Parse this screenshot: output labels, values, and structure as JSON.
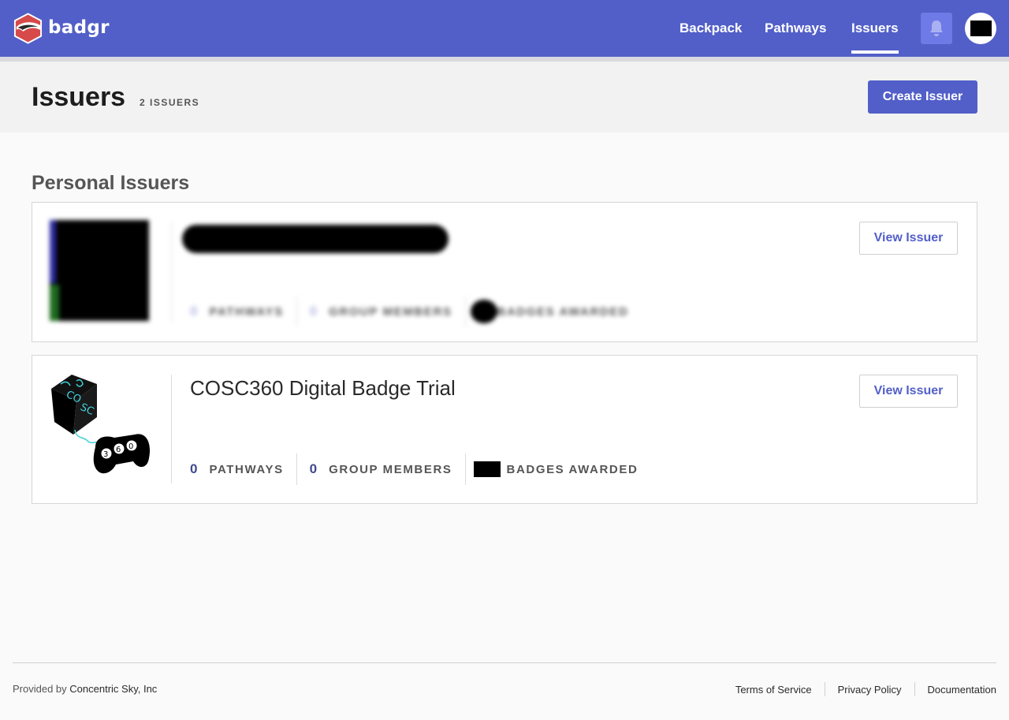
{
  "brand": {
    "name": "badgr",
    "primary": "#525fc8",
    "accent": "#6e7ae6"
  },
  "nav": {
    "items": [
      {
        "label": "Backpack",
        "active": false
      },
      {
        "label": "Pathways",
        "active": false
      },
      {
        "label": "Issuers",
        "active": true
      }
    ],
    "notifications_icon": "bell-icon"
  },
  "header": {
    "title": "Issuers",
    "count": "2 ISSUERS",
    "create_button": "Create Issuer"
  },
  "section": {
    "title": "Personal Issuers"
  },
  "issuers": [
    {
      "name": "",
      "redacted": true,
      "view_button": "View Issuer",
      "stats": [
        {
          "value": "0",
          "label": "PATHWAYS"
        },
        {
          "value": "0",
          "label": "GROUP MEMBERS"
        },
        {
          "value": "",
          "label": "BADGES AWARDED"
        }
      ]
    },
    {
      "name": "COSC360 Digital Badge Trial",
      "redacted": false,
      "view_button": "View Issuer",
      "stats": [
        {
          "value": "0",
          "label": "PATHWAYS"
        },
        {
          "value": "0",
          "label": "GROUP MEMBERS"
        },
        {
          "value": "",
          "label": "BADGES AWARDED"
        }
      ]
    }
  ],
  "footer": {
    "provided_by": "Provided by",
    "provider": "Concentric Sky, Inc",
    "links": [
      "Terms of Service",
      "Privacy Policy",
      "Documentation"
    ]
  }
}
